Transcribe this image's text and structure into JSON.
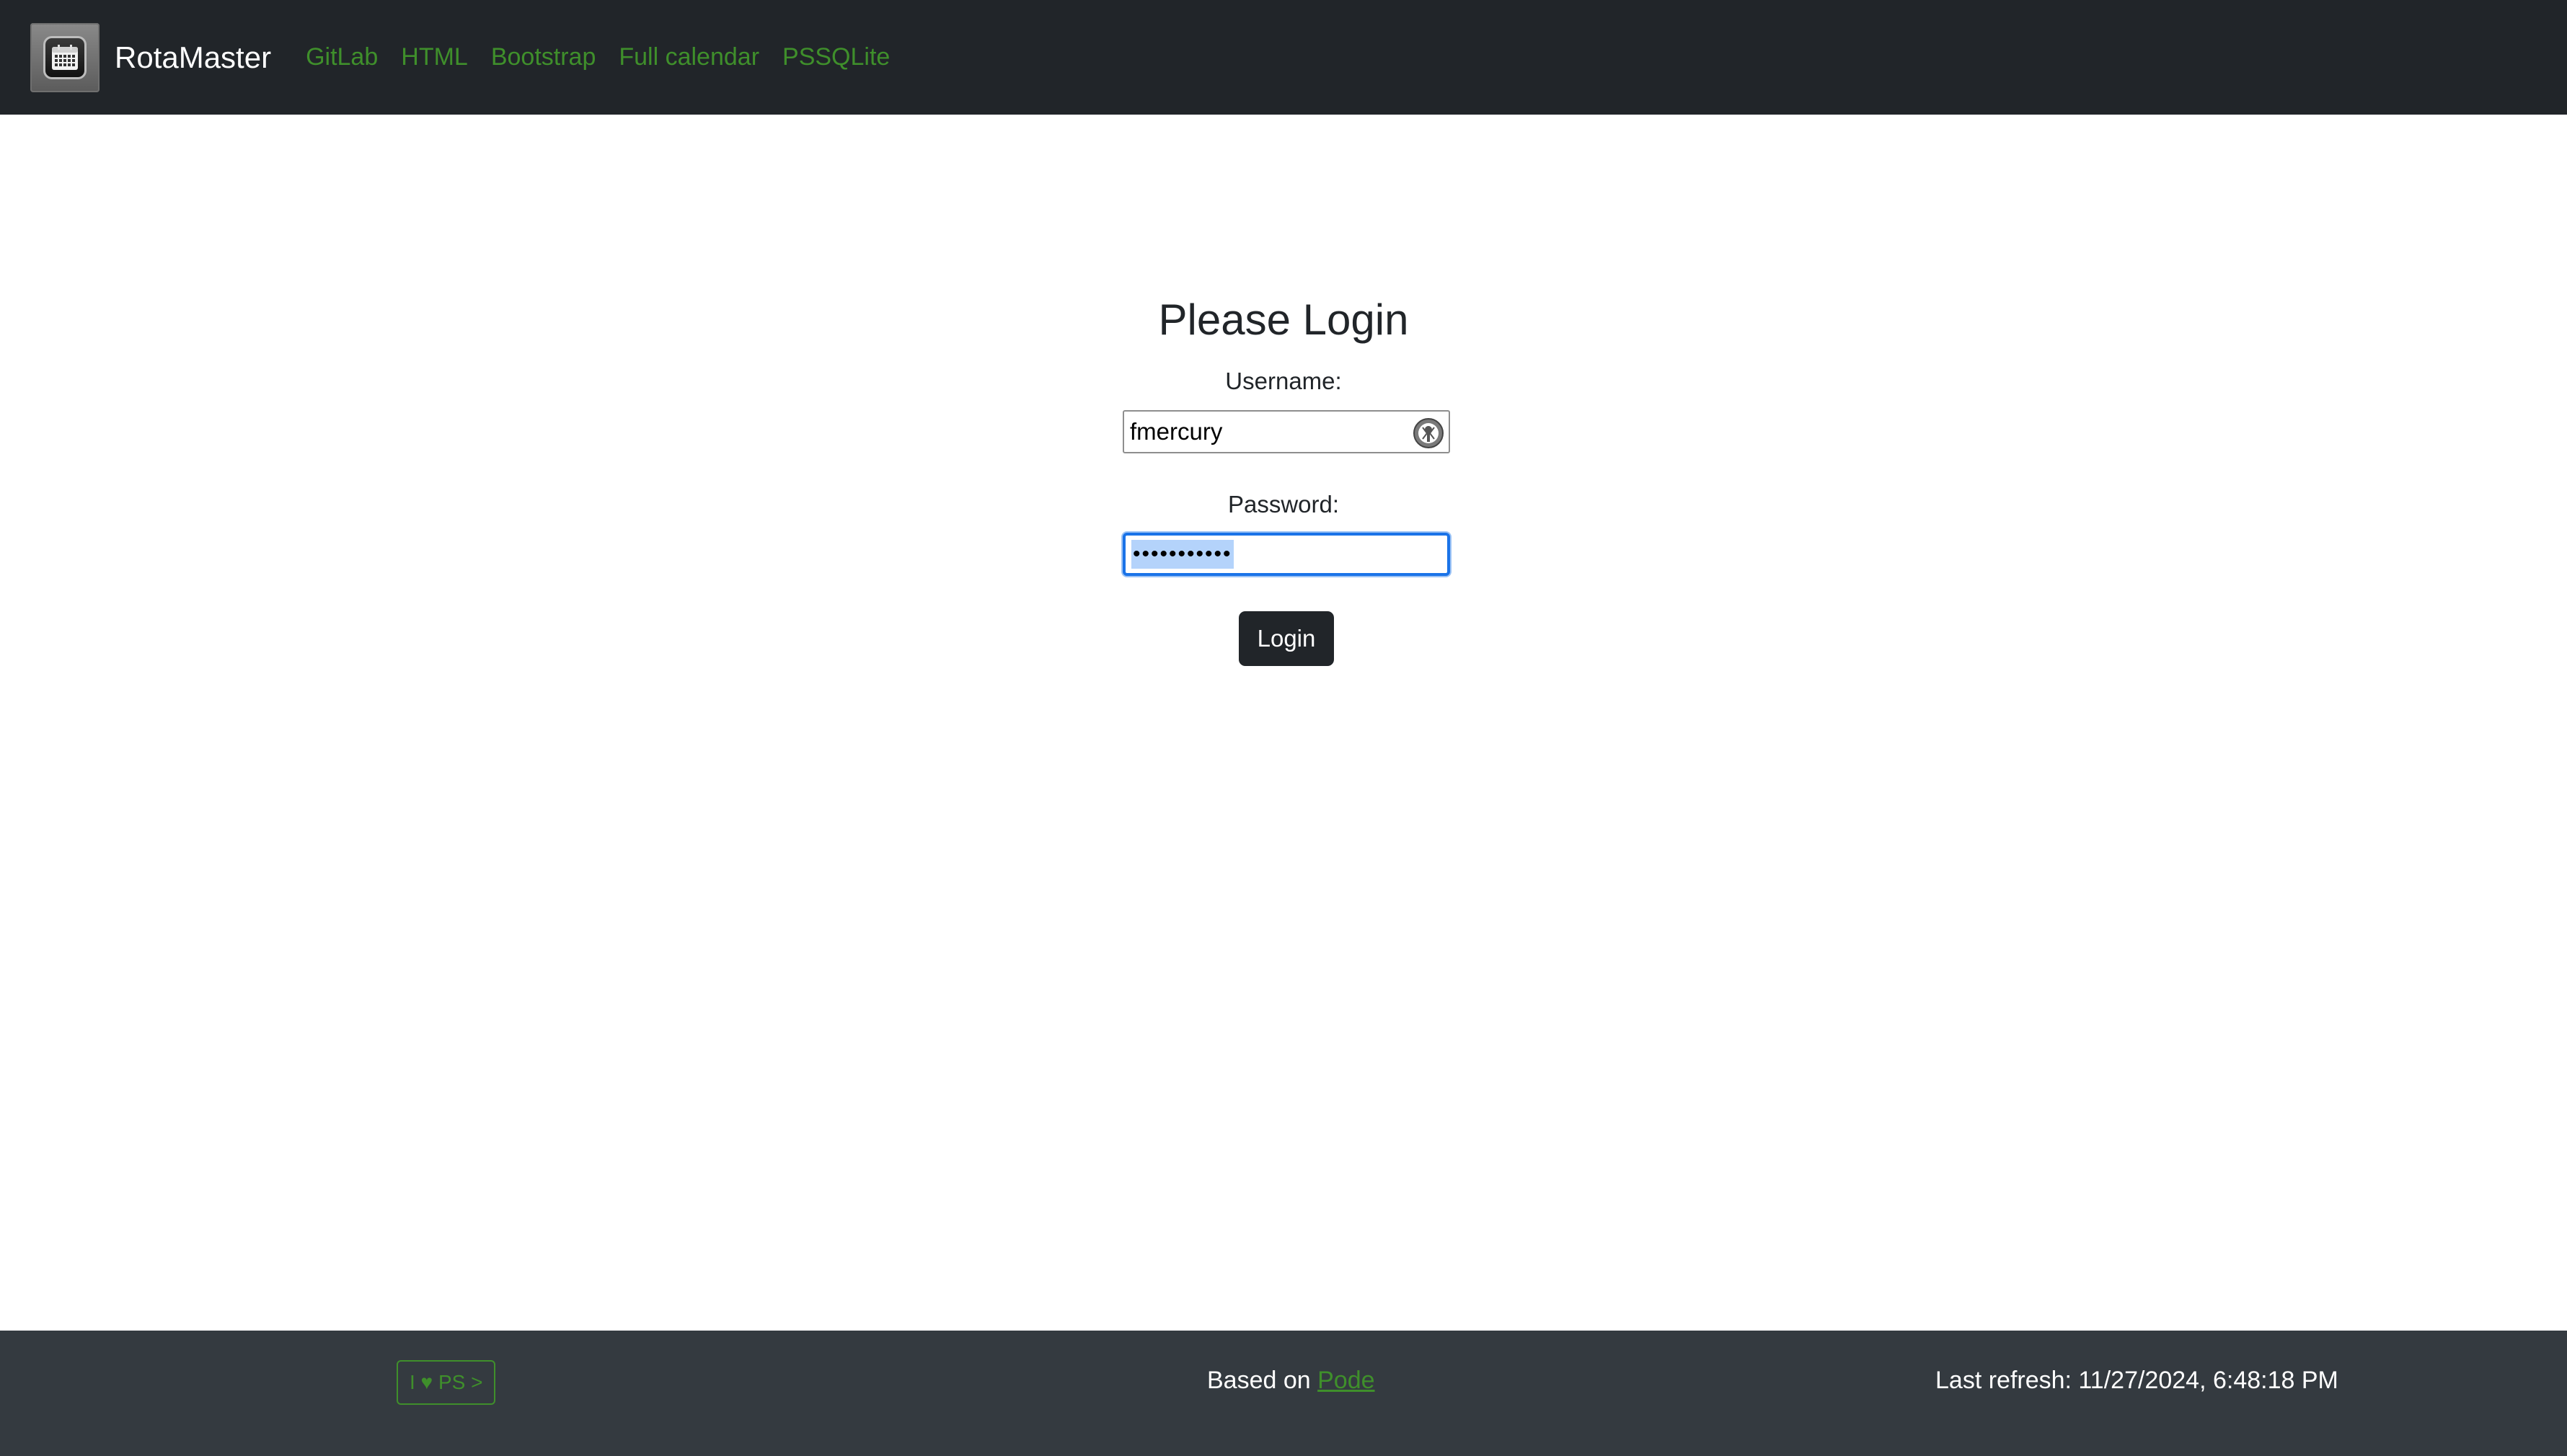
{
  "navbar": {
    "brand": "RotaMaster",
    "logo_icon": "calendar-icon",
    "links": [
      "GitLab",
      "HTML",
      "Bootstrap",
      "Full calendar",
      "PSSQLite"
    ],
    "link_color": "#3f8f2b",
    "background": "#212529"
  },
  "login": {
    "title": "Please Login",
    "username_label": "Username:",
    "username_value": "fmercury",
    "username_icon": "password-manager-key-icon",
    "password_label": "Password:",
    "password_value": "•••••••••••",
    "button_label": "Login"
  },
  "footer": {
    "badge": "I ♥ PS >",
    "based_on_prefix": "Based on ",
    "based_on_link": "Pode",
    "last_refresh": "Last refresh: 11/27/2024, 6:48:18 PM"
  }
}
